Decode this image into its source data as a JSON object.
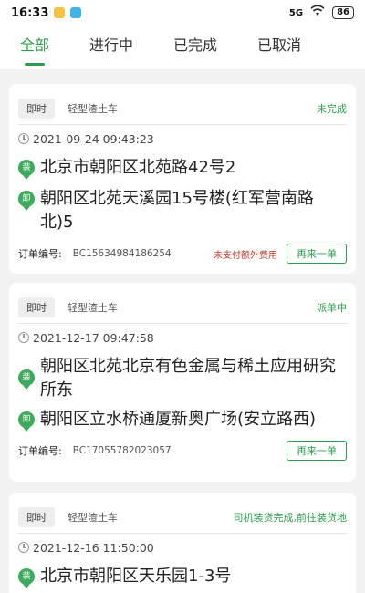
{
  "status_bar": {
    "time": "16:33",
    "signal": "5G",
    "battery": "86",
    "app_icon_colors": [
      "#f5c242",
      "#3fb4e6"
    ]
  },
  "tabs": [
    {
      "label": "全部",
      "active": true
    },
    {
      "label": "进行中",
      "active": false
    },
    {
      "label": "已完成",
      "active": false
    },
    {
      "label": "已取消",
      "active": false
    }
  ],
  "colors": {
    "accent": "#2e9c4f",
    "warning": "#c0392b"
  },
  "orders": [
    {
      "timing": "即时",
      "vehicle": "轻型渣土车",
      "status": "未完成",
      "time": "2021-09-24 09:43:23",
      "load_tag": "装",
      "load_address": "北京市朝阳区北苑路42号2",
      "unload_tag": "卸",
      "unload_address": "朝阳区北苑天溪园15号楼(红军营南路北)5",
      "order_label": "订单编号:",
      "order_no": "BC15634984186254",
      "fee_note": "未支付额外费用",
      "reorder": "再来一单"
    },
    {
      "timing": "即时",
      "vehicle": "轻型渣土车",
      "status": "派单中",
      "time": "2021-12-17 09:47:58",
      "load_tag": "装",
      "load_address": "朝阳区北苑北京有色金属与稀土应用研究所东",
      "unload_tag": "卸",
      "unload_address": "朝阳区立水桥通厦新奥广场(安立路西)",
      "order_label": "订单编号:",
      "order_no": "BC17055782023057",
      "fee_note": "",
      "reorder": "再来一单"
    },
    {
      "timing": "即时",
      "vehicle": "轻型渣土车",
      "status": "司机装货完成,前往装货地",
      "time": "2021-12-16 11:50:00",
      "load_tag": "装",
      "load_address": "北京市朝阳区天乐园1-3号"
    }
  ]
}
